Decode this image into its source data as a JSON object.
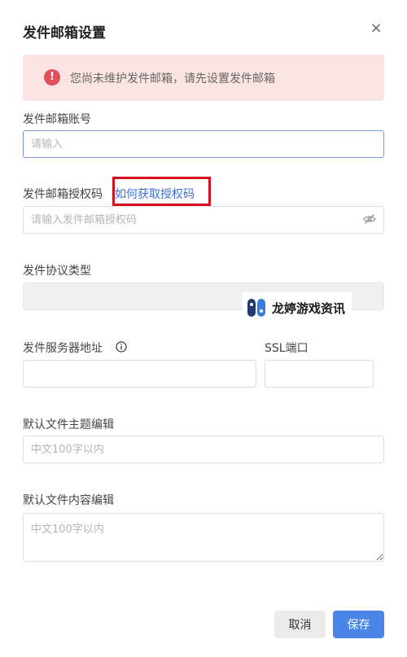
{
  "dialog": {
    "title": "发件邮箱设置",
    "close_label": "×"
  },
  "alert": {
    "icon_glyph": "!",
    "text": "您尚未维护发件邮箱，请先设置发件邮箱",
    "color": "#e0505a"
  },
  "form": {
    "account": {
      "label": "发件邮箱账号",
      "value": "",
      "placeholder": "请输入"
    },
    "auth_code": {
      "label": "发件邮箱授权码",
      "help_link": "如何获取授权码",
      "value": "",
      "placeholder": "请输入发件邮箱授权码",
      "toggle_icon": "eye-off-icon"
    },
    "protocol": {
      "label": "发件协议类型",
      "selected_value": ""
    },
    "server": {
      "label": "发件服务器地址",
      "info_icon": "info-icon",
      "value": "",
      "placeholder": ""
    },
    "ssl_port": {
      "label": "SSL端口",
      "value": "",
      "placeholder": ""
    },
    "default_subject": {
      "label": "默认文件主题编辑",
      "value": "",
      "placeholder": "中文100字以内"
    },
    "default_content": {
      "label": "默认文件内容编辑",
      "value": "",
      "placeholder": "中文100字以内"
    }
  },
  "footer": {
    "cancel_label": "取消",
    "save_label": "保存",
    "accent_color": "#4a86e8"
  },
  "watermark": {
    "text": "龙婷游戏资讯"
  },
  "annotation": {
    "highlight_color": "#d6101e"
  }
}
